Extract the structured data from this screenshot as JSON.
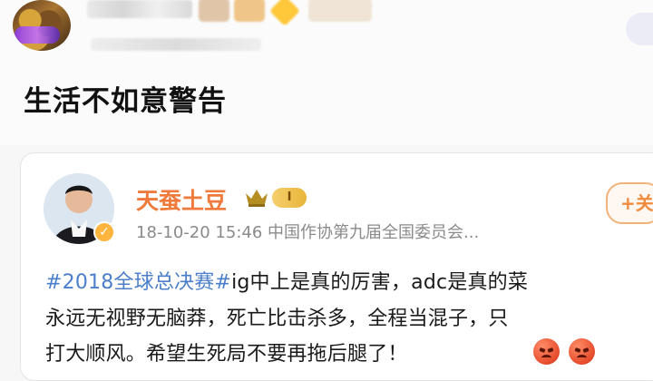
{
  "post": {
    "title": "生活不如意警告"
  },
  "top_user": {
    "avatar": "user-avatar",
    "follow": ""
  },
  "quoted_post": {
    "author_name": "天蚕土豆",
    "level_badge": "I",
    "meta": "18-10-20 15:46  中国作协第九届全国委员会...",
    "follow_label": "+关",
    "lines": [
      {
        "segments": [
          {
            "text": "#2018全球总决赛#",
            "kind": "hashtag"
          },
          {
            "text": "ig中上是真的厉害，adc是真的菜",
            "kind": "text"
          }
        ]
      },
      {
        "segments": [
          {
            "text": "永远无视野无脑莽，死亡比击杀多，全程当混子，只",
            "kind": "text"
          }
        ]
      },
      {
        "segments": [
          {
            "text": "打大顺风。希望生死局不要再拖后腿了！",
            "kind": "text"
          }
        ]
      }
    ]
  },
  "icons": {
    "crown": "crown-icon",
    "verify": "verified-badge-icon",
    "angry": "angry-face-icon"
  },
  "colors": {
    "author": "#ef7a3b",
    "hashtag": "#4b7fcb",
    "meta": "#8a8a8a",
    "follow": "#f08b3d"
  }
}
